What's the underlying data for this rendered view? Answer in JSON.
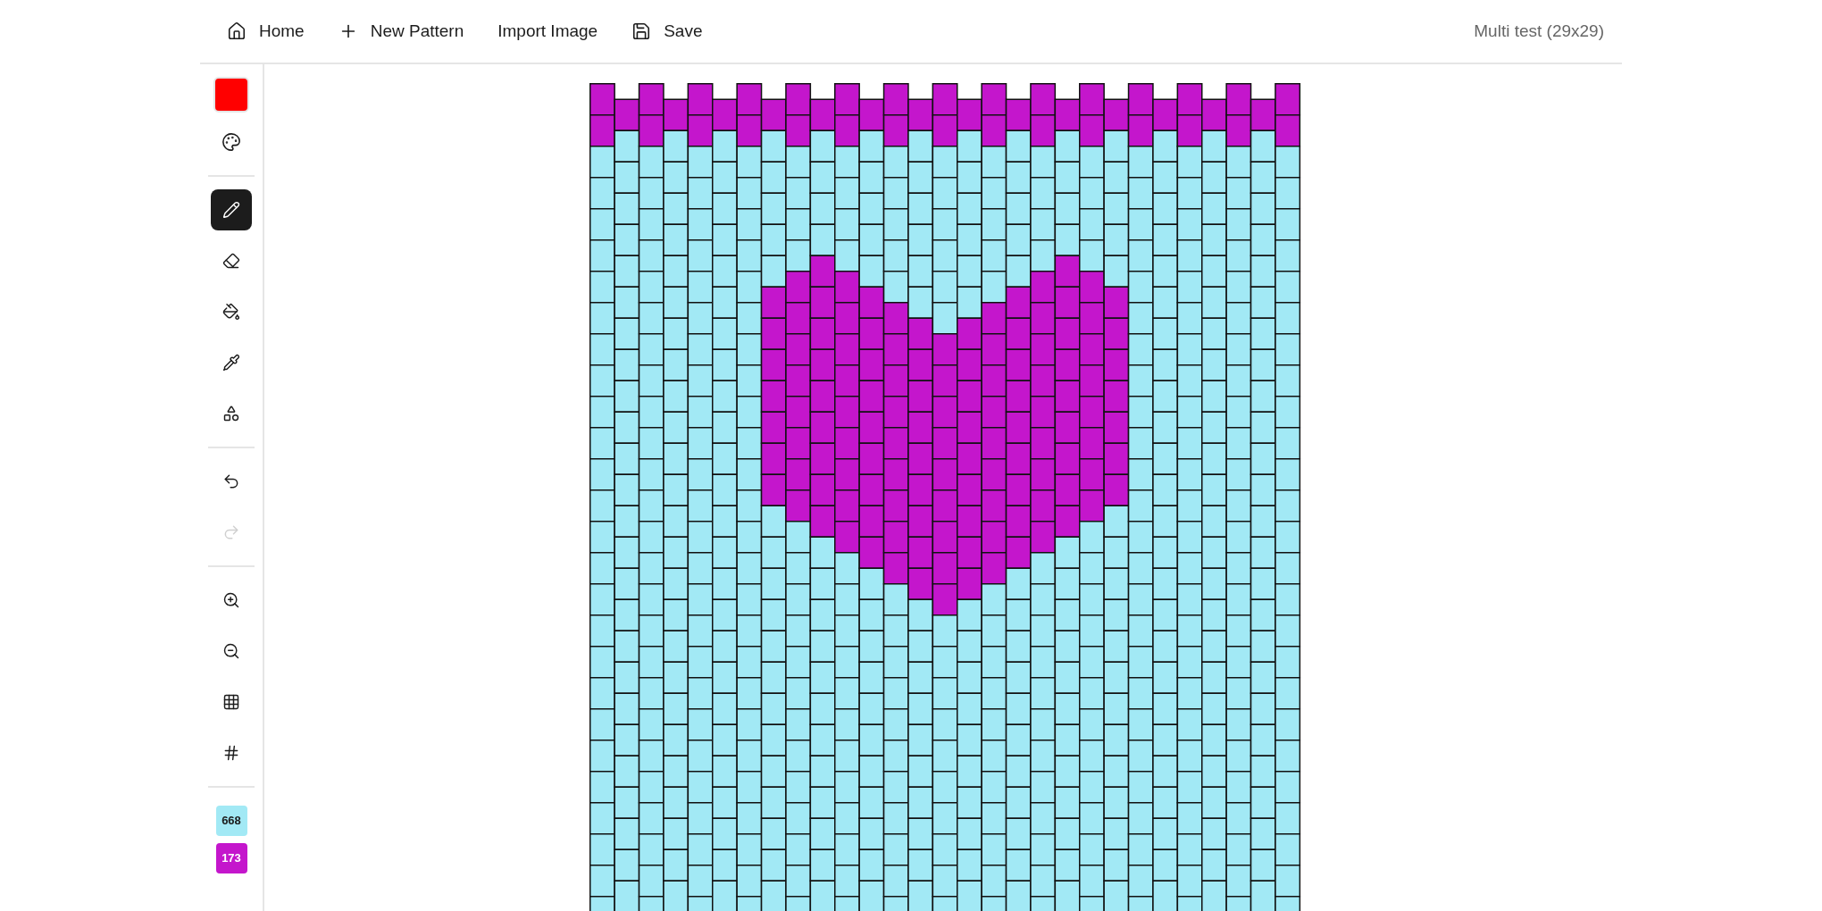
{
  "header": {
    "nav": [
      {
        "label": "Home",
        "kind": "home"
      },
      {
        "label": "New Pattern",
        "kind": "new"
      },
      {
        "label": "Import Image",
        "kind": "import"
      },
      {
        "label": "Save",
        "kind": "save"
      }
    ],
    "title": "Multi test (29x29)"
  },
  "toolbar": {
    "current": {
      "color": "#ff0000"
    },
    "tools": [
      {
        "kind": "pencil",
        "selected": true
      },
      {
        "kind": "eraser",
        "selected": false
      },
      {
        "kind": "fill",
        "selected": false
      },
      {
        "kind": "pipette",
        "selected": false
      },
      {
        "kind": "shapes",
        "selected": false
      }
    ],
    "history": [
      {
        "kind": "undo",
        "disabled": false
      },
      {
        "kind": "redo",
        "disabled": true
      }
    ],
    "view": [
      {
        "kind": "zoom-in"
      },
      {
        "kind": "zoom-out"
      },
      {
        "kind": "grid"
      },
      {
        "kind": "hash"
      }
    ]
  },
  "palette": [
    {
      "count": "668",
      "color": "#a2e9f5"
    },
    {
      "count": "173",
      "color": "#c416cc"
    }
  ]
}
